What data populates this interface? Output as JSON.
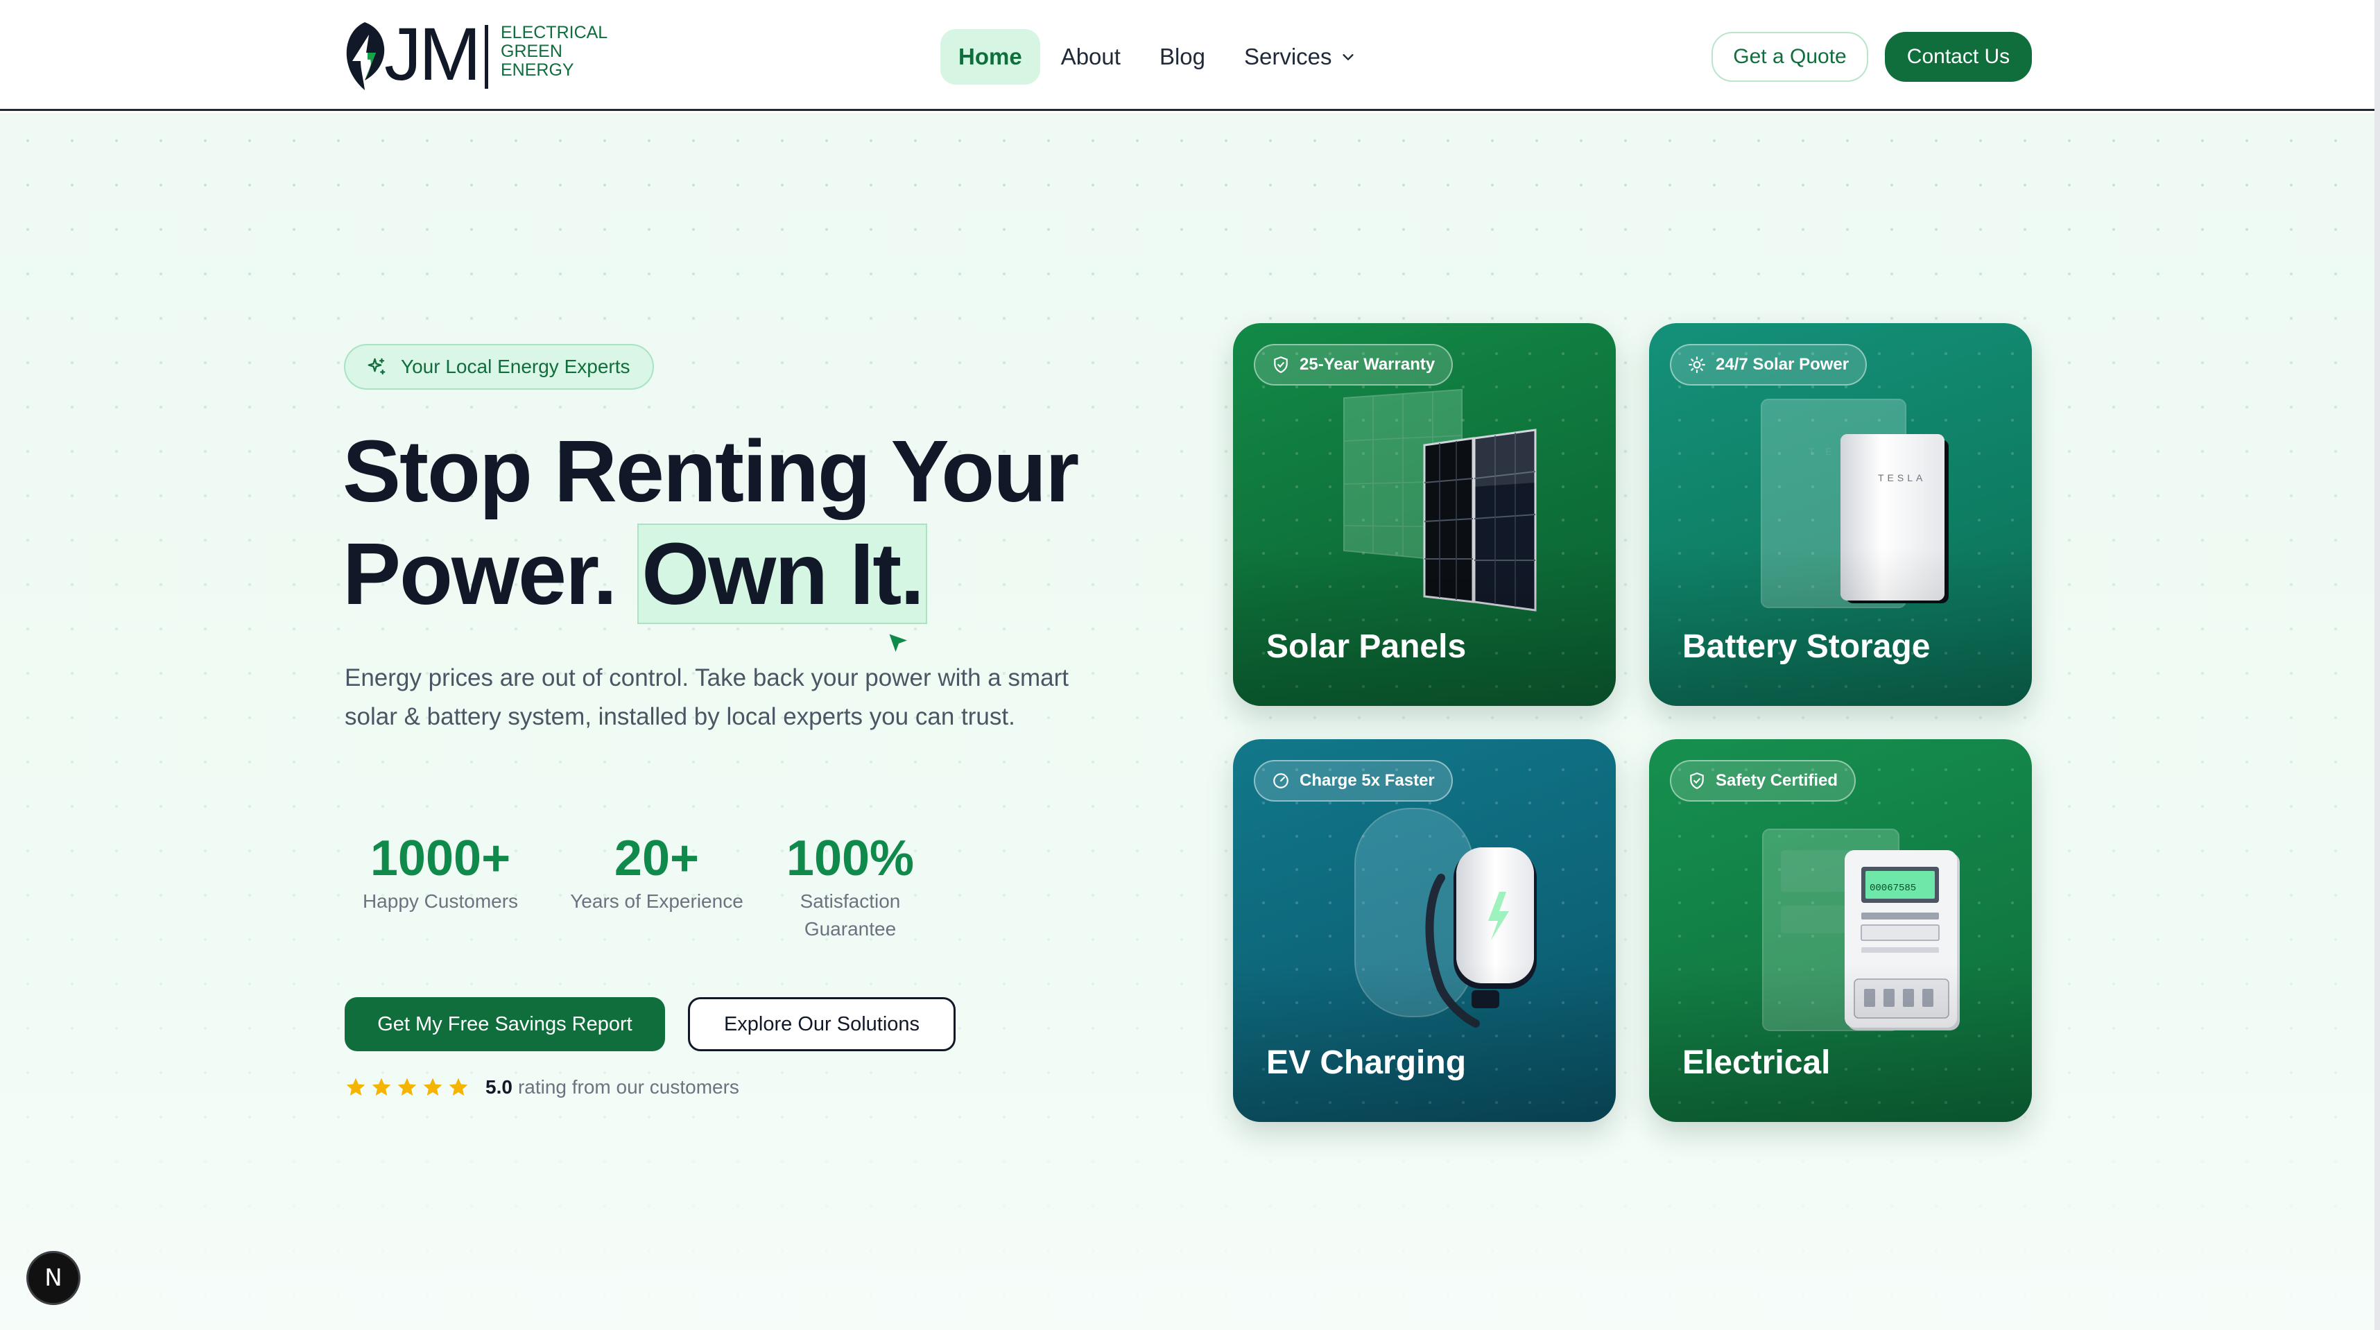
{
  "brand": {
    "mark": "JM",
    "line1": "ELECTRICAL",
    "line2": "GREEN",
    "line3": "ENERGY",
    "color": "#0f6e3c"
  },
  "nav": {
    "items": [
      {
        "label": "Home",
        "active": true
      },
      {
        "label": "About",
        "active": false
      },
      {
        "label": "Blog",
        "active": false
      },
      {
        "label": "Services",
        "active": false
      }
    ],
    "services_icon": "chevron-down-icon"
  },
  "header_actions": {
    "quote_label": "Get a Quote",
    "contact_label": "Contact Us"
  },
  "hero": {
    "badge": "Your Local Energy Experts",
    "headline_line1": "Stop Renting Your",
    "headline_line2_plain": "Power.",
    "headline_line2_highlight": "Own It.",
    "subtext": "Energy prices are out of control. Take back your power with a smart solar & battery system, installed by local experts you can trust.",
    "stats": [
      {
        "value": "1000+",
        "label": "Happy Customers"
      },
      {
        "value": "20+",
        "label": "Years of Experience"
      },
      {
        "value": "100%",
        "label": "Satisfaction Guarantee"
      }
    ],
    "primary_cta": "Get My Free Savings Report",
    "secondary_cta": "Explore Our Solutions",
    "rating": {
      "stars": 5,
      "score": "5.0",
      "text": "rating from our customers",
      "star_color": "#f5b400"
    }
  },
  "cards": [
    {
      "tag": "25-Year Warranty",
      "tag_icon": "shield-check-icon",
      "title": "Solar Panels",
      "color": "#0f7a3f"
    },
    {
      "tag": "24/7 Solar Power",
      "tag_icon": "sun-icon",
      "title": "Battery Storage",
      "color": "#0f8068"
    },
    {
      "tag": "Charge 5x Faster",
      "tag_icon": "gauge-icon",
      "title": "EV Charging",
      "color": "#0e5f72"
    },
    {
      "tag": "Safety Certified",
      "tag_icon": "shield-check-icon",
      "title": "Electrical",
      "color": "#137a45"
    }
  ],
  "device_labels": {
    "battery_brand": "TESLA",
    "meter_reading": "00067585"
  },
  "dev_badge": "N",
  "colors": {
    "accent": "#0f6e3c",
    "stat_green": "#0f8a4a",
    "hero_bg": "#eefaf3",
    "highlight": "#d4f6e2"
  }
}
